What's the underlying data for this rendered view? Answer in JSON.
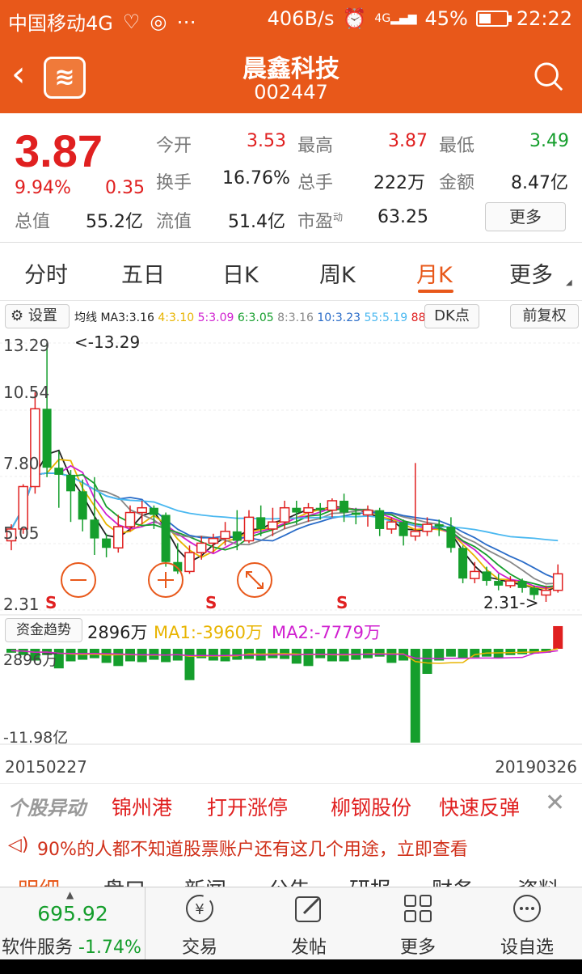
{
  "status_bar": {
    "carrier": "中国移动4G",
    "speed": "406B/s",
    "network": "4G",
    "battery": "45%",
    "battery_level": 0.45,
    "time": "22:22"
  },
  "header": {
    "title": "晨鑫科技",
    "code": "002447"
  },
  "quote": {
    "price": "3.87",
    "change_pct": "9.94%",
    "change": "0.35",
    "open_label": "今开",
    "open": "3.53",
    "high_label": "最高",
    "high": "3.87",
    "low_label": "最低",
    "low": "3.49",
    "turnover_label": "换手",
    "turnover": "16.76%",
    "volume_label": "总手",
    "volume": "222万",
    "amount_label": "金额",
    "amount": "8.47亿",
    "mcap_label": "总值",
    "mcap": "55.2亿",
    "float_label": "流值",
    "float": "51.4亿",
    "pe_label": "市盈",
    "pe_sup": "动",
    "pe": "63.25",
    "more_button": "更多"
  },
  "tabs": [
    {
      "label": "分时"
    },
    {
      "label": "五日"
    },
    {
      "label": "日K"
    },
    {
      "label": "周K"
    },
    {
      "label": "月K"
    },
    {
      "label": "更多"
    }
  ],
  "active_tab": "月K",
  "toolbar": {
    "settings": "设置",
    "ma_title": "均线",
    "ma3": "MA3:3.16",
    "ma4": "4:3.10",
    "ma5": "5:3.09",
    "ma6": "6:3.05",
    "ma8": "8:3.16",
    "ma10": "10:3.23",
    "ma55": "55:5.19",
    "ma88": "88",
    "dk": "DK点",
    "adjust": "前复权"
  },
  "chart": {
    "y_labels": [
      "13.29",
      "10.54",
      "7.80",
      "5.05",
      "2.31"
    ],
    "max_note": "<-13.29",
    "min_note": "2.31->",
    "signal": "S",
    "fund_y_top": "2896万",
    "fund_y_bottom": "-11.98亿"
  },
  "chart_data": {
    "type": "candlestick",
    "ylim": [
      2.31,
      13.29
    ],
    "max": 13.29,
    "min": 2.31,
    "candles": [
      [
        4.9,
        5.4,
        4.5,
        5.6
      ],
      [
        5.4,
        7.2,
        5.2,
        7.3
      ],
      [
        7.2,
        10.5,
        6.9,
        11.2
      ],
      [
        10.5,
        8.0,
        7.6,
        13.29
      ],
      [
        8.0,
        7.7,
        6.3,
        8.7
      ],
      [
        7.7,
        7.0,
        5.7,
        7.9
      ],
      [
        7.0,
        5.8,
        5.3,
        7.5
      ],
      [
        5.8,
        5.0,
        4.3,
        7.6
      ],
      [
        5.0,
        4.6,
        4.2,
        5.2
      ],
      [
        4.6,
        5.5,
        4.4,
        6.0
      ],
      [
        5.5,
        6.1,
        5.3,
        6.4
      ],
      [
        6.1,
        6.3,
        5.6,
        6.6
      ],
      [
        6.3,
        6.0,
        5.4,
        6.4
      ],
      [
        6.0,
        4.0,
        3.8,
        6.1
      ],
      [
        4.0,
        3.6,
        3.5,
        4.8
      ],
      [
        3.6,
        4.4,
        3.5,
        4.7
      ],
      [
        4.4,
        4.8,
        4.1,
        5.1
      ],
      [
        4.8,
        5.0,
        4.4,
        5.2
      ],
      [
        5.0,
        5.3,
        4.7,
        5.7
      ],
      [
        5.3,
        4.9,
        4.5,
        6.2
      ],
      [
        4.9,
        5.9,
        4.8,
        6.2
      ],
      [
        5.9,
        5.4,
        5.1,
        6.4
      ],
      [
        5.4,
        5.7,
        5.1,
        6.3
      ],
      [
        5.7,
        6.3,
        5.4,
        6.6
      ],
      [
        6.3,
        6.1,
        5.6,
        6.6
      ],
      [
        6.1,
        6.3,
        5.7,
        6.5
      ],
      [
        6.3,
        6.2,
        5.8,
        6.5
      ],
      [
        6.2,
        6.6,
        5.9,
        6.7
      ],
      [
        6.6,
        6.1,
        5.7,
        6.9
      ],
      [
        6.1,
        6.0,
        5.6,
        6.3
      ],
      [
        6.0,
        6.2,
        5.5,
        6.4
      ],
      [
        6.2,
        5.4,
        5.1,
        6.3
      ],
      [
        5.4,
        5.7,
        5.2,
        5.9
      ],
      [
        5.7,
        5.1,
        4.7,
        5.8
      ],
      [
        5.1,
        5.3,
        4.9,
        8.2
      ],
      [
        5.3,
        5.6,
        5.1,
        5.9
      ],
      [
        5.6,
        5.5,
        5.1,
        5.8
      ],
      [
        5.5,
        4.6,
        4.4,
        5.9
      ],
      [
        4.6,
        3.3,
        3.1,
        4.7
      ],
      [
        3.3,
        3.6,
        3.1,
        4.0
      ],
      [
        3.6,
        3.2,
        3.0,
        3.8
      ],
      [
        3.2,
        3.0,
        2.8,
        3.5
      ],
      [
        3.0,
        3.2,
        2.9,
        3.4
      ],
      [
        3.2,
        2.9,
        2.7,
        3.3
      ],
      [
        2.9,
        2.6,
        2.4,
        3.0
      ],
      [
        2.6,
        2.8,
        2.31,
        3.0
      ],
      [
        2.8,
        3.5,
        2.7,
        3.9
      ]
    ],
    "x_start": "20150227",
    "x_end": "20190326",
    "fund_flow_values_wan": [
      -500,
      -800,
      -1500,
      -800,
      -2500,
      -1600,
      -1400,
      -1200,
      -1800,
      -2200,
      -1600,
      -1700,
      -1400,
      -1700,
      -1500,
      -4000,
      -1200,
      -1500,
      -1600,
      -1400,
      -1300,
      -1500,
      -1200,
      -1300,
      -1900,
      -2200,
      -1200,
      -1600,
      -1600,
      -1400,
      -1200,
      -1000,
      -1800,
      -1500,
      -11980,
      -3200,
      -1500,
      -1000,
      -1200,
      -1100,
      -1000,
      -1200,
      -800,
      -700,
      -600,
      -500,
      2896
    ]
  },
  "fund": {
    "button": "资金趋势",
    "value": "2896万",
    "ma1": "MA1:-3960万",
    "ma2": "MA2:-7779万"
  },
  "dates": {
    "start": "20150227",
    "end": "20190326"
  },
  "ticker": {
    "brand": "个股异动",
    "items": [
      "锦州港",
      "打开涨停",
      "柳钢股份",
      "快速反弹"
    ]
  },
  "ad": {
    "text": "90%的人都不知道股票账户还有这几个用途，立即查看"
  },
  "subtabs": [
    "明细",
    "盘口",
    "新闻",
    "公告",
    "研报",
    "财务",
    "资料"
  ],
  "bottom": {
    "index_value": "695.92",
    "index_name": "软件服务",
    "index_change": "-1.74%",
    "nav": [
      {
        "label": "交易",
        "icon": "yen-coin-icon"
      },
      {
        "label": "发帖",
        "icon": "edit-icon"
      },
      {
        "label": "更多",
        "icon": "grid-icon"
      },
      {
        "label": "设自选",
        "icon": "dots-icon"
      }
    ]
  },
  "colors": {
    "brand": "#e8581a",
    "up": "#e02020",
    "down": "#159e2c"
  }
}
